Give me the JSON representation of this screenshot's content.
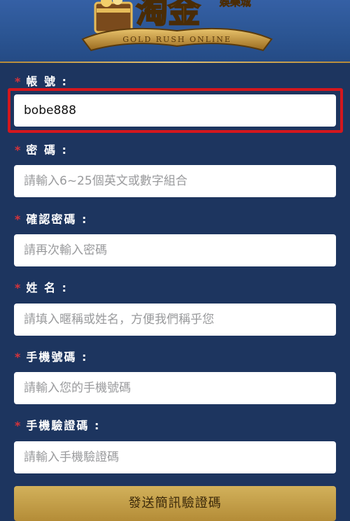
{
  "header": {
    "logo_main": "淘金",
    "logo_sub": "娛樂城",
    "logo_ribbon": "GOLD RUSH ONLINE",
    "accent_color": "#d8b46a"
  },
  "form": {
    "required_marker": "*",
    "fields": [
      {
        "label": "帳 號 :",
        "value": "bobe888",
        "placeholder": ""
      },
      {
        "label": "密 碼 :",
        "value": "",
        "placeholder": "請輸入6~25個英文或數字組合"
      },
      {
        "label": "確認密碼 :",
        "value": "",
        "placeholder": "請再次輸入密碼"
      },
      {
        "label": "姓 名 :",
        "value": "",
        "placeholder": "請填入暱稱或姓名，方便我們稱乎您"
      },
      {
        "label": "手機號碼 :",
        "value": "",
        "placeholder": "請輸入您的手機號碼"
      },
      {
        "label": "手機驗證碼 :",
        "value": "",
        "placeholder": "請輸入手機驗證碼"
      }
    ],
    "sms_button_label": "發送簡訊驗證碼"
  },
  "colors": {
    "background": "#1d355f",
    "required_star": "#d8333a",
    "highlight_box": "#d4171d",
    "button_gold": "#c9a44e"
  }
}
